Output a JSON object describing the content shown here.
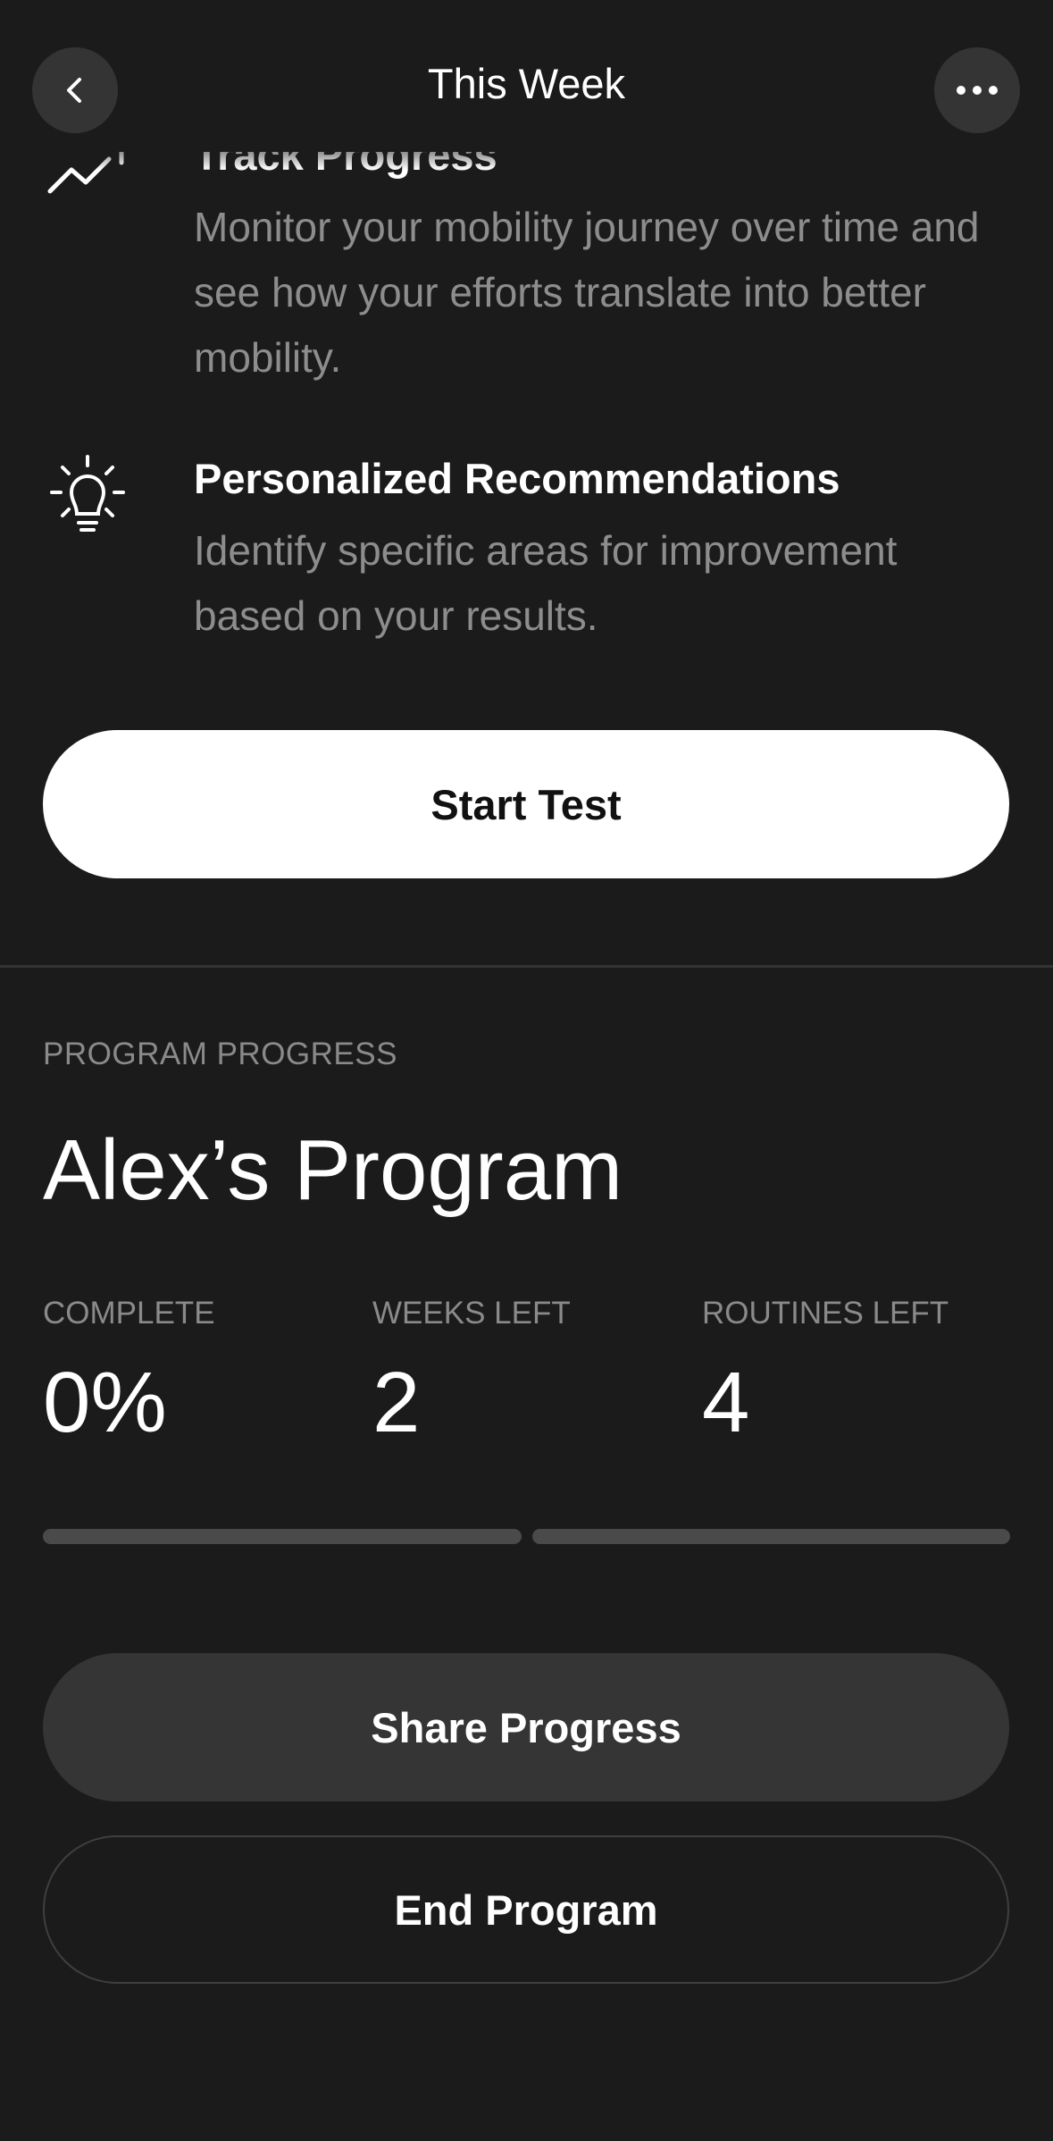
{
  "header": {
    "title": "This Week",
    "back_icon": "chevron-left-icon",
    "more_icon": "more-horizontal-icon"
  },
  "features": [
    {
      "icon": "trending-up-icon",
      "title": "Track Progress",
      "description": "Monitor your mobility journey over time and see how your efforts translate into better mobility."
    },
    {
      "icon": "lightbulb-icon",
      "title": "Personalized Recommendations",
      "description": "Identify specific areas for improvement based on your results."
    }
  ],
  "start_button": {
    "label": "Start Test"
  },
  "program": {
    "section_label": "PROGRAM PROGRESS",
    "title": "Alex’s Program",
    "stats": [
      {
        "label": "COMPLETE",
        "value": "0%"
      },
      {
        "label": "WEEKS LEFT",
        "value": "2"
      },
      {
        "label": "ROUTINES LEFT",
        "value": "4"
      }
    ],
    "progress_segments": [
      {
        "week": 1,
        "progress": 0
      },
      {
        "week": 2,
        "progress": 0
      }
    ]
  },
  "actions": {
    "share_label": "Share Progress",
    "end_label": "End Program"
  },
  "colors": {
    "background": "#1b1b1b",
    "primary_button": "#ffffff",
    "secondary_button": "#353535",
    "muted_text": "#8a8a8a"
  }
}
